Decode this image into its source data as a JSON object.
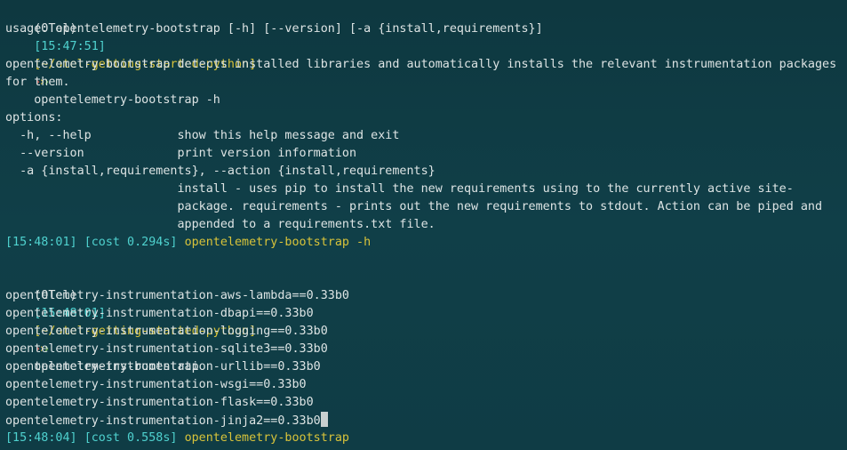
{
  "terminal": {
    "prompt1": {
      "env": "(OTel)",
      "time": "[15:47:51]",
      "path": "[~/otel-getting-started-python]",
      "command": "opentelemetry-bootstrap -h"
    },
    "help_output": [
      "usage: opentelemetry-bootstrap [-h] [--version] [-a {install,requirements}]",
      "",
      "opentelemetry-bootstrap detects installed libraries and automatically installs the relevant instrumentation packages",
      "for them.",
      "",
      "options:",
      "  -h, --help            show this help message and exit",
      "  --version             print version information",
      "  -a {install,requirements}, --action {install,requirements}",
      "                        install - uses pip to install the new requirements using to the currently active site-",
      "                        package. requirements - prints out the new requirements to stdout. Action can be piped and",
      "                        appended to a requirements.txt file."
    ],
    "status1": {
      "time": "[15:48:01]",
      "cost": "[cost 0.294s]",
      "command": "opentelemetry-bootstrap -h"
    },
    "prompt2": {
      "env": "(OTel)",
      "time": "[15:48:01]",
      "path": "[~/otel-getting-started-python]",
      "command": "opentelemetry-bootstrap"
    },
    "requirements_output": [
      "opentelemetry-instrumentation-aws-lambda==0.33b0",
      "opentelemetry-instrumentation-dbapi==0.33b0",
      "opentelemetry-instrumentation-logging==0.33b0",
      "opentelemetry-instrumentation-sqlite3==0.33b0",
      "opentelemetry-instrumentation-urllib==0.33b0",
      "opentelemetry-instrumentation-wsgi==0.33b0",
      "opentelemetry-instrumentation-flask==0.33b0",
      "opentelemetry-instrumentation-jinja2==0.33b0"
    ],
    "status2": {
      "time": "[15:48:04]",
      "cost": "[cost 0.558s]",
      "command": "opentelemetry-bootstrap"
    },
    "arrow_glyph": "›",
    "colors": {
      "background": "#0f3b44",
      "cyan": "#4fd2cf",
      "yellow": "#d8c33a",
      "text": "#d6dede",
      "arrow_red": "#e0554a",
      "arrow_yellow": "#e2c53a",
      "arrow_green": "#7ac943"
    }
  }
}
